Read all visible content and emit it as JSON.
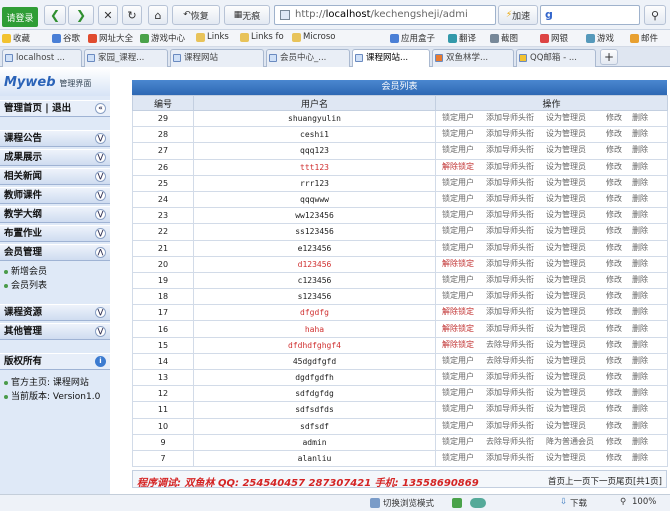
{
  "toolbar": {
    "login": "请登录",
    "restore": "恢复",
    "no_trace": "无痕",
    "url_prefix": "http://",
    "url_host": "localhost",
    "url_path": "/kechengsheji/admi",
    "speed": "加速"
  },
  "bookmarks": [
    "收藏",
    "谷歌",
    "网址大全",
    "游戏中心",
    "Links",
    "Links fo",
    "Microso",
    "应用盒子",
    "翻译",
    "截图",
    "网银",
    "游戏",
    "邮件"
  ],
  "tabs": [
    "localhost ...",
    "家园_课程...",
    "课程网站",
    "会员中心_...",
    "课程网站...",
    "双鱼林学...",
    "QQ邮箱 - ..."
  ],
  "sidebar": {
    "logo": "Myweb",
    "logo_sub": "管理界面",
    "top_link": "管理首页 | 退出",
    "menu1": [
      "课程公告",
      "成果展示",
      "相关新闻",
      "教师课件",
      "教学大纲",
      "布置作业",
      "会员管理"
    ],
    "member_sub": [
      "新增会员",
      "会员列表"
    ],
    "menu2": [
      "课程资源",
      "其他管理"
    ],
    "copyright_title": "版权所有",
    "official": "官方主页: 课程网站",
    "version": "当前版本: Version1.0"
  },
  "main": {
    "title": "会员列表",
    "headers": [
      "编号",
      "用户名",
      "操作"
    ],
    "rows": [
      {
        "id": "29",
        "name": "shuangyulin",
        "red": false,
        "ops": [
          "锁定用户",
          "添加导师头衔",
          "设为管理员",
          "修改",
          "删除"
        ]
      },
      {
        "id": "28",
        "name": "ceshi1",
        "red": false,
        "ops": [
          "锁定用户",
          "添加导师头衔",
          "设为管理员",
          "修改",
          "删除"
        ]
      },
      {
        "id": "27",
        "name": "qqq123",
        "red": false,
        "ops": [
          "锁定用户",
          "添加导师头衔",
          "设为管理员",
          "修改",
          "删除"
        ]
      },
      {
        "id": "26",
        "name": "ttt123",
        "red": true,
        "ops": [
          "解除锁定",
          "添加导师头衔",
          "设为管理员",
          "修改",
          "删除"
        ]
      },
      {
        "id": "25",
        "name": "rrr123",
        "red": false,
        "ops": [
          "锁定用户",
          "添加导师头衔",
          "设为管理员",
          "修改",
          "删除"
        ]
      },
      {
        "id": "24",
        "name": "qqqwww",
        "red": false,
        "ops": [
          "锁定用户",
          "添加导师头衔",
          "设为管理员",
          "修改",
          "删除"
        ]
      },
      {
        "id": "23",
        "name": "ww123456",
        "red": false,
        "ops": [
          "锁定用户",
          "添加导师头衔",
          "设为管理员",
          "修改",
          "删除"
        ]
      },
      {
        "id": "22",
        "name": "ss123456",
        "red": false,
        "ops": [
          "锁定用户",
          "添加导师头衔",
          "设为管理员",
          "修改",
          "删除"
        ]
      },
      {
        "id": "21",
        "name": "e123456",
        "red": false,
        "ops": [
          "锁定用户",
          "添加导师头衔",
          "设为管理员",
          "修改",
          "删除"
        ]
      },
      {
        "id": "20",
        "name": "d123456",
        "red": true,
        "ops": [
          "解除锁定",
          "添加导师头衔",
          "设为管理员",
          "修改",
          "删除"
        ]
      },
      {
        "id": "19",
        "name": "c123456",
        "red": false,
        "ops": [
          "锁定用户",
          "添加导师头衔",
          "设为管理员",
          "修改",
          "删除"
        ]
      },
      {
        "id": "18",
        "name": "s123456",
        "red": false,
        "ops": [
          "锁定用户",
          "添加导师头衔",
          "设为管理员",
          "修改",
          "删除"
        ]
      },
      {
        "id": "17",
        "name": "dfgdfg",
        "red": true,
        "ops": [
          "解除锁定",
          "添加导师头衔",
          "设为管理员",
          "修改",
          "删除"
        ]
      },
      {
        "id": "16",
        "name": "haha",
        "red": true,
        "ops": [
          "解除锁定",
          "添加导师头衔",
          "设为管理员",
          "修改",
          "删除"
        ]
      },
      {
        "id": "15",
        "name": "dfdhdfghgf4",
        "red": true,
        "ops": [
          "解除锁定",
          "去除导师头衔",
          "设为管理员",
          "修改",
          "删除"
        ]
      },
      {
        "id": "14",
        "name": "45dgdfgfd",
        "red": false,
        "ops": [
          "锁定用户",
          "去除导师头衔",
          "设为管理员",
          "修改",
          "删除"
        ]
      },
      {
        "id": "13",
        "name": "dgdfgdfh",
        "red": false,
        "ops": [
          "锁定用户",
          "添加导师头衔",
          "设为管理员",
          "修改",
          "删除"
        ]
      },
      {
        "id": "12",
        "name": "sdfdgfdg",
        "red": false,
        "ops": [
          "锁定用户",
          "添加导师头衔",
          "设为管理员",
          "修改",
          "删除"
        ]
      },
      {
        "id": "11",
        "name": "sdfsdfds",
        "red": false,
        "ops": [
          "锁定用户",
          "添加导师头衔",
          "设为管理员",
          "修改",
          "删除"
        ]
      },
      {
        "id": "10",
        "name": "sdfsdf",
        "red": false,
        "ops": [
          "锁定用户",
          "添加导师头衔",
          "设为管理员",
          "修改",
          "删除"
        ]
      },
      {
        "id": "9",
        "name": "admin",
        "red": false,
        "ops": [
          "锁定用户",
          "去除导师头衔",
          "降为普通会员",
          "修改",
          "删除"
        ]
      },
      {
        "id": "7",
        "name": "alanliu",
        "red": false,
        "ops": [
          "锁定用户",
          "添加导师头衔",
          "设为管理员",
          "修改",
          "删除"
        ]
      }
    ],
    "footer": "程序调试: 双鱼林 QQ: 254540457 287307421 手机: 13558690869",
    "pager": "首页上一页下一页尾页[共1页]"
  },
  "status": {
    "mode": "切换浏览模式",
    "download": "下载",
    "zoom": "100%"
  }
}
